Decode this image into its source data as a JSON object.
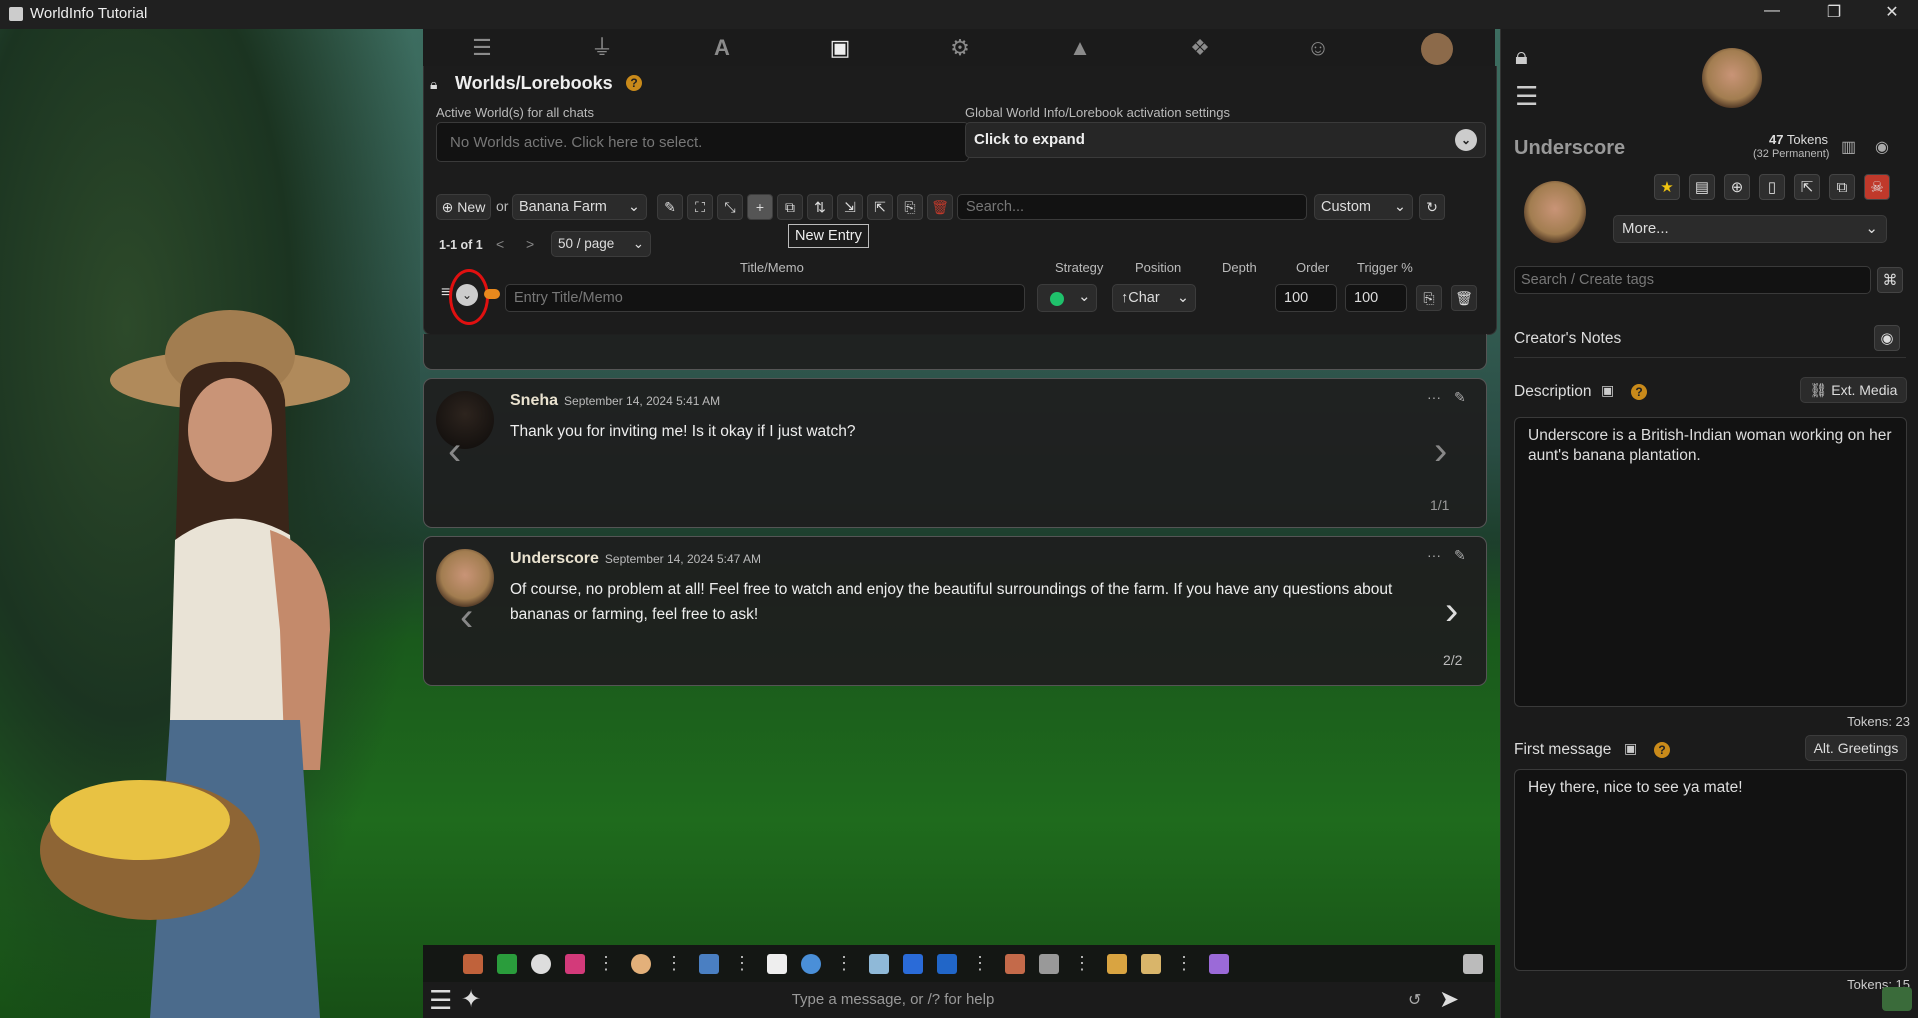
{
  "window": {
    "title": "WorldInfo Tutorial",
    "minimize": "—",
    "restore": "❐",
    "close": "✕"
  },
  "worlds": {
    "title": "Worlds/Lorebooks",
    "help": "?",
    "active_label": "Active World(s) for all chats",
    "active_placeholder": "No Worlds active. Click here to select.",
    "global_label": "Global World Info/Lorebook activation settings",
    "global_expand": "Click to expand",
    "new_btn": "New",
    "or_text": "or",
    "selected_world": "Banana Farm",
    "search_placeholder": "Search...",
    "sort": "Custom",
    "pagination": "1-1 of 1",
    "prev": "<",
    "next": ">",
    "per_page": "50 / page",
    "tooltip": "New Entry",
    "columns": {
      "title": "Title/Memo",
      "strategy": "Strategy",
      "position": "Position",
      "depth": "Depth",
      "order": "Order",
      "trigger": "Trigger %"
    },
    "entry": {
      "title_placeholder": "Entry Title/Memo",
      "position": "↑Char",
      "order": "100",
      "trigger": "100"
    }
  },
  "messages": [
    {
      "name": "Sneha",
      "date": "September 14, 2024 5:41 AM",
      "text": "Thank you for inviting me! Is it okay if I just watch?",
      "counter": "1/1"
    },
    {
      "name": "Underscore",
      "date": "September 14, 2024 5:47 AM",
      "text": "Of course, no problem at all! Feel free to watch and enjoy the beautiful surroundings of the farm. If you have any questions about bananas or farming, feel free to ask!",
      "counter": "2/2"
    }
  ],
  "character": {
    "name": "Underscore",
    "tokens_count": "47",
    "tokens_label": "Tokens",
    "tokens_permanent": "(32 Permanent)",
    "more": "More...",
    "tags_placeholder": "Search / Create tags",
    "creators_notes": "Creator's Notes",
    "description_label": "Description",
    "ext_media": "Ext. Media",
    "description": "Underscore is a British-Indian woman working on her aunt's banana plantation.",
    "desc_tokens": "Tokens: 23",
    "first_message_label": "First message",
    "alt_greetings": "Alt. Greetings",
    "first_message": "Hey there, nice to see ya mate!",
    "first_tokens": "Tokens: 15"
  },
  "composer": {
    "placeholder": "Type a message, or /? for help"
  },
  "colors": {
    "accent_orange": "#e8891d",
    "strategy_green": "#1fc16b",
    "delete_red": "#c0392b",
    "annotation_red": "#e01010"
  }
}
